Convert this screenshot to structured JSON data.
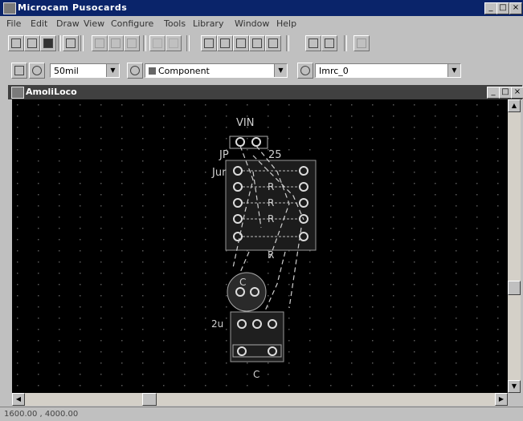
{
  "app": {
    "title": "Microcam Pusocards",
    "buttons": {
      "minimize": "_",
      "maximize": "□",
      "close": "×"
    }
  },
  "menu": [
    "File",
    "Edit",
    "Draw",
    "View",
    "Configure",
    "Tools",
    "Library",
    "Window",
    "Help"
  ],
  "toolbar_icons": [
    "new-icon",
    "open-icon",
    "save-icon",
    "print-icon",
    "cut-icon",
    "copy-icon",
    "paste-icon",
    "undo-icon",
    "redo-icon",
    "wire-icon",
    "part-icon",
    "trace-icon",
    "pad-icon",
    "text-icon",
    "line-icon",
    "arc-icon",
    "zoom-icon"
  ],
  "toolbar2": {
    "grid": "50mil",
    "layer": "Component",
    "net": "Imrc_0"
  },
  "document": {
    "title": "AmoliLoco",
    "buttons": {
      "minimize": "_",
      "maximize": "□",
      "close": "×"
    }
  },
  "pcb": {
    "labels": [
      "VIN",
      "JP",
      "25",
      "Jur",
      "R",
      "R",
      "R",
      "R",
      "C",
      "2u",
      "C"
    ]
  },
  "status": {
    "coords": "1600.00 , 4000.00"
  },
  "colors": {
    "canvas": "#000000",
    "traces": "#d8d8d8",
    "grid": "#5a5a5a"
  }
}
